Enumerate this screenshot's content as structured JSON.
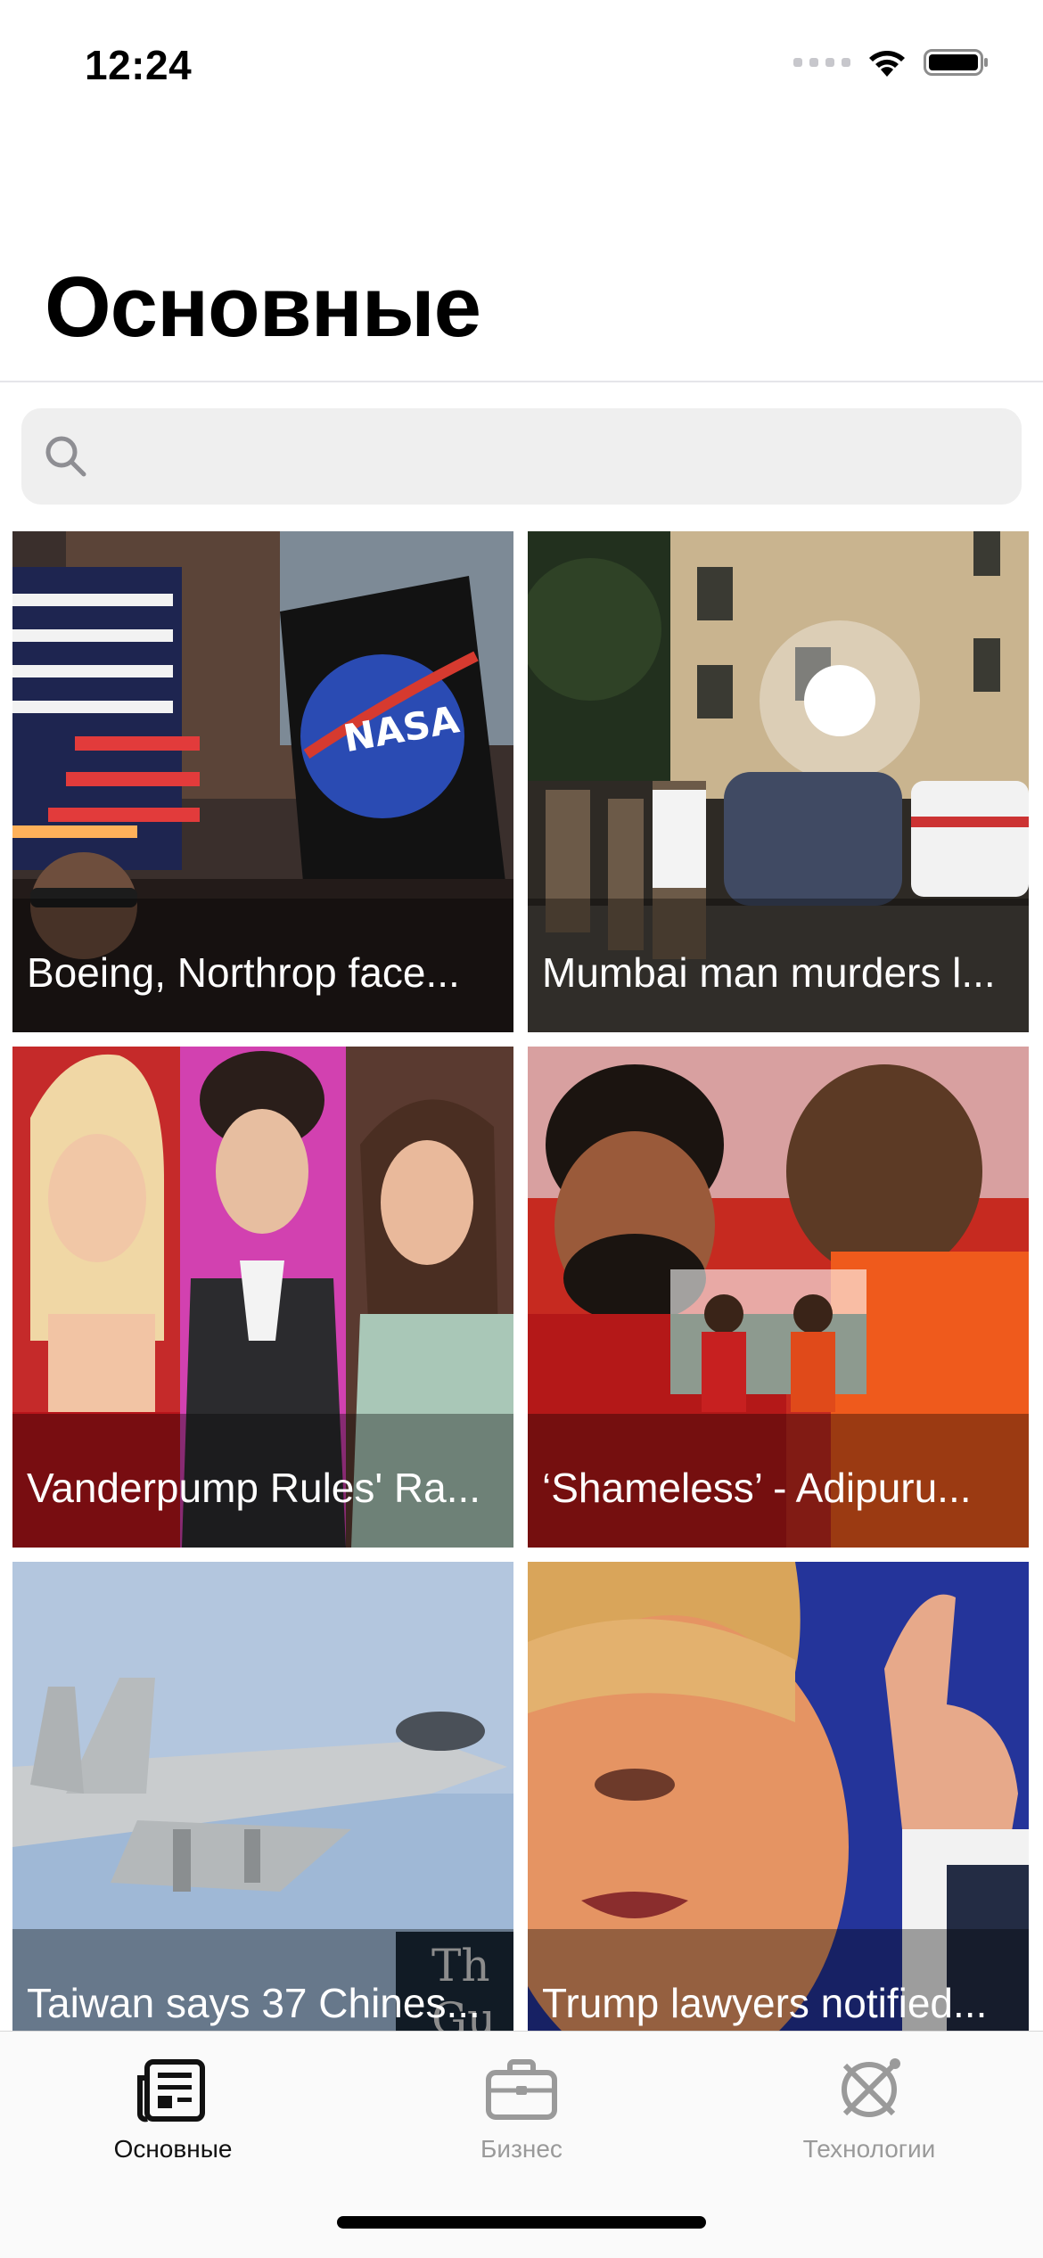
{
  "status_bar": {
    "time": "12:24"
  },
  "header": {
    "title": "Основные"
  },
  "search": {
    "placeholder": ""
  },
  "articles": [
    {
      "caption": "Boeing, Northrop face..."
    },
    {
      "caption": "Mumbai man murders l..."
    },
    {
      "caption": "Vanderpump Rules' Ra..."
    },
    {
      "caption": "‘Shameless’ - Adipuru..."
    },
    {
      "caption": "Taiwan says 37 Chines..."
    },
    {
      "caption": "Trump lawyers notified..."
    }
  ],
  "tabs": [
    {
      "label": "Основные",
      "icon": "newspaper-icon",
      "active": true
    },
    {
      "label": "Бизнес",
      "icon": "briefcase-icon",
      "active": false
    },
    {
      "label": "Технологии",
      "icon": "globe-tech-icon",
      "active": false
    }
  ],
  "colors": {
    "active_tab": "#111111",
    "inactive_tab": "#9a9a9a",
    "search_bg": "#efefef"
  }
}
